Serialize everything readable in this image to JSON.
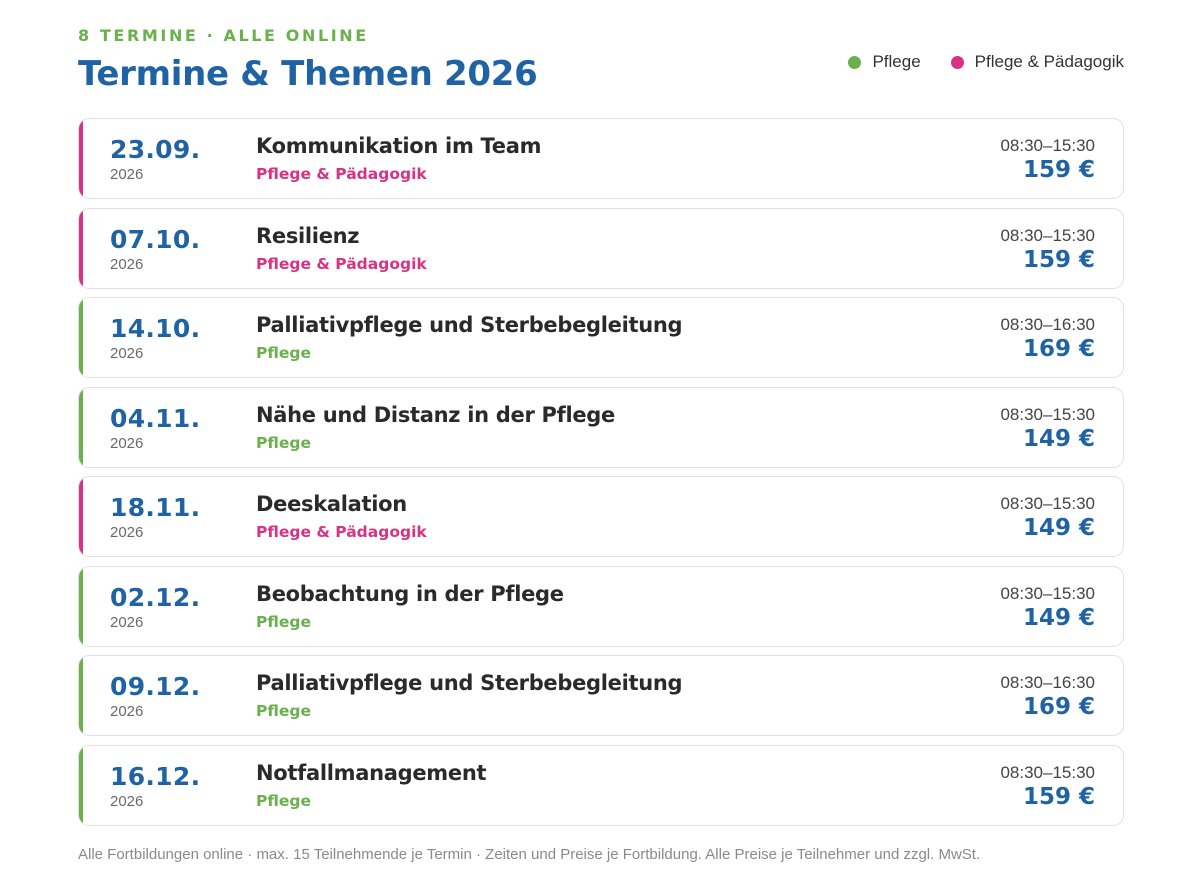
{
  "header": {
    "kicker": "8 TERMINE · ALLE ONLINE",
    "title": "Termine & Themen 2026"
  },
  "colors": {
    "pflege": "#6ab04c",
    "paedagogik": "#d63384",
    "primary": "#1f63a5"
  },
  "legend": [
    {
      "label": "Pflege",
      "color": "#6ab04c"
    },
    {
      "label": "Pflege & Pädagogik",
      "color": "#d63384"
    }
  ],
  "events": [
    {
      "date": "23.09.",
      "year": "2026",
      "title": "Kommunikation im Team",
      "category": "Pflege & Pädagogik",
      "accent": "#d63384",
      "time": "08:30–15:30",
      "price": "159 €"
    },
    {
      "date": "07.10.",
      "year": "2026",
      "title": "Resilienz",
      "category": "Pflege & Pädagogik",
      "accent": "#d63384",
      "time": "08:30–15:30",
      "price": "159 €"
    },
    {
      "date": "14.10.",
      "year": "2026",
      "title": "Palliativpflege und Sterbebegleitung",
      "category": "Pflege",
      "accent": "#6ab04c",
      "time": "08:30–16:30",
      "price": "169 €"
    },
    {
      "date": "04.11.",
      "year": "2026",
      "title": "Nähe und Distanz in der Pflege",
      "category": "Pflege",
      "accent": "#6ab04c",
      "time": "08:30–15:30",
      "price": "149 €"
    },
    {
      "date": "18.11.",
      "year": "2026",
      "title": "Deeskalation",
      "category": "Pflege & Pädagogik",
      "accent": "#d63384",
      "time": "08:30–15:30",
      "price": "149 €"
    },
    {
      "date": "02.12.",
      "year": "2026",
      "title": "Beobachtung in der Pflege",
      "category": "Pflege",
      "accent": "#6ab04c",
      "time": "08:30–15:30",
      "price": "149 €"
    },
    {
      "date": "09.12.",
      "year": "2026",
      "title": "Palliativpflege und Sterbebegleitung",
      "category": "Pflege",
      "accent": "#6ab04c",
      "time": "08:30–16:30",
      "price": "169 €"
    },
    {
      "date": "16.12.",
      "year": "2026",
      "title": "Notfallmanagement",
      "category": "Pflege",
      "accent": "#6ab04c",
      "time": "08:30–15:30",
      "price": "159 €"
    }
  ],
  "footnote": "Alle Fortbildungen online · max. 15 Teilnehmende je Termin · Zeiten und Preise je Fortbildung. Alle Preise je Teilnehmer und zzgl. MwSt."
}
